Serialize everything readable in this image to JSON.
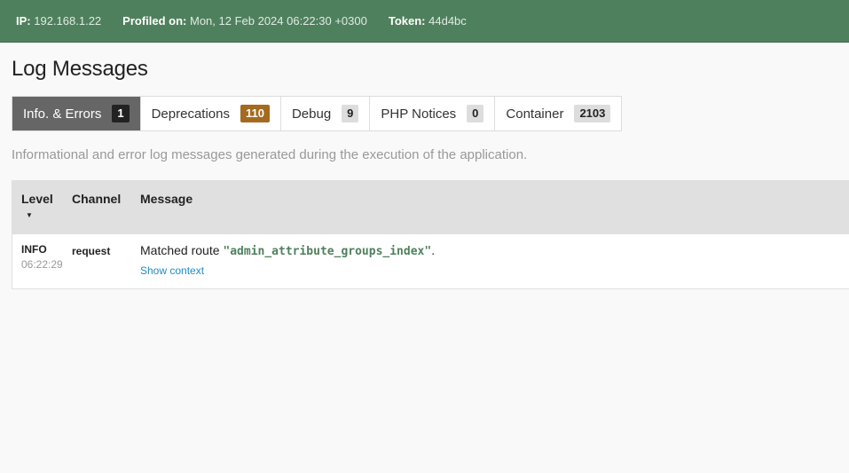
{
  "summary": {
    "ip_label": "IP:",
    "ip_value": "192.168.1.22",
    "profiled_label": "Profiled on:",
    "profiled_value": "Mon, 12 Feb 2024 06:22:30 +0300",
    "token_label": "Token:",
    "token_value": "44d4bc"
  },
  "page": {
    "title": "Log Messages",
    "description": "Informational and error log messages generated during the execution of the application."
  },
  "tabs": [
    {
      "label": "Info. & Errors",
      "count": "1",
      "active": true
    },
    {
      "label": "Deprecations",
      "count": "110",
      "active": false
    },
    {
      "label": "Debug",
      "count": "9",
      "active": false
    },
    {
      "label": "PHP Notices",
      "count": "0",
      "active": false
    },
    {
      "label": "Container",
      "count": "2103",
      "active": false
    }
  ],
  "table": {
    "headers": {
      "level": "Level",
      "channel": "Channel",
      "message": "Message"
    },
    "sort_icon": "sort-down-icon",
    "rows": [
      {
        "level": "INFO",
        "time": "06:22:29",
        "channel": "request",
        "message_prefix": "Matched route ",
        "quote_open": "\"",
        "message_arg": "admin_attribute_groups_index",
        "quote_close": "\"",
        "message_suffix": ".",
        "context_link": "Show context"
      }
    ]
  },
  "colors": {
    "header_bg": "#4f805d",
    "active_tab_bg": "#666666",
    "warning_badge": "#a46a1f",
    "link": "#218bc3"
  }
}
